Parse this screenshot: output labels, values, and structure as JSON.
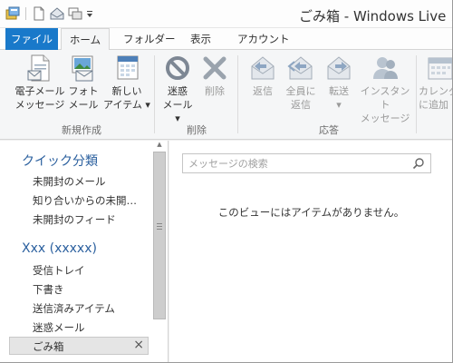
{
  "window": {
    "title": "ごみ箱 - Windows Live メ"
  },
  "qat": {
    "icons": [
      "app-icon",
      "new-icon",
      "send-receive-icon",
      "sync-icon",
      "customize-icon"
    ]
  },
  "tabs": {
    "file": "ファイル",
    "home": "ホーム",
    "folder": "フォルダー",
    "view": "表示",
    "account": "アカウント"
  },
  "ribbon": {
    "groups": {
      "new": "新規作成",
      "delete": "削除",
      "respond": "応答"
    },
    "email": {
      "line1": "電子メール",
      "line2": "メッセージ"
    },
    "photo": {
      "line1": "フォト",
      "line2": "メール"
    },
    "newitems": {
      "line1": "新しい",
      "line2": "アイテム ▾"
    },
    "junk": {
      "line1": "迷惑",
      "line2": "メール ▾"
    },
    "del": {
      "line1": "削除"
    },
    "reply": {
      "line1": "返信"
    },
    "replyall": {
      "line1": "全員に",
      "line2": "返信"
    },
    "forward": {
      "line1": "転送",
      "line2": "▾"
    },
    "im": {
      "line1": "インスタント",
      "line2": "メッセージ"
    },
    "calendar": {
      "line1": "カレンダ",
      "line2": "に追加"
    }
  },
  "nav": {
    "quick_head": "クイック分類",
    "quick_items": [
      "未開封のメール",
      "知り合いからの未開封…",
      "未開封のフィード"
    ],
    "account_head": "Xxx (xxxxx)",
    "account_items": [
      "受信トレイ",
      "下書き",
      "送信済みアイテム",
      "迷惑メール"
    ],
    "selected": "ごみ箱",
    "selected_close": "×",
    "scroll_up": "▲"
  },
  "main": {
    "search_placeholder": "メッセージの検索",
    "empty_text": "このビューにはアイテムがありません。"
  },
  "colors": {
    "accent": "#1979ca",
    "nav_heading": "#2a5f9e"
  }
}
